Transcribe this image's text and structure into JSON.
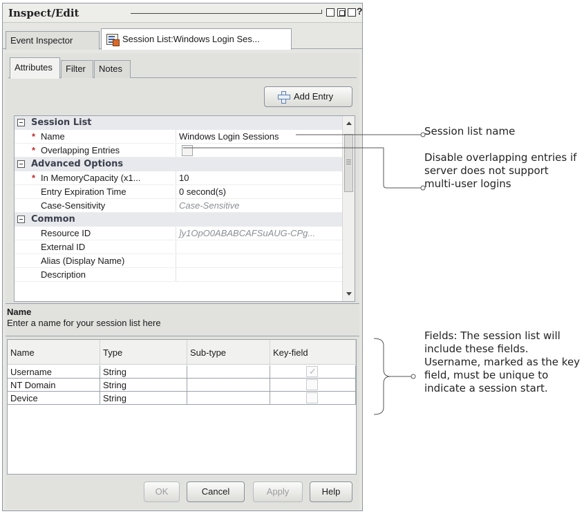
{
  "window": {
    "title": "Inspect/Edit",
    "help": "?"
  },
  "doc_tabs": [
    {
      "label": "Event Inspector"
    },
    {
      "label": "Session List:Windows Login Ses...",
      "icon": "session-list-icon"
    }
  ],
  "sub_tabs": [
    {
      "label": "Attributes"
    },
    {
      "label": "Filter"
    },
    {
      "label": "Notes"
    }
  ],
  "add_entry": {
    "label": "Add Entry",
    "icon": "plus-icon"
  },
  "properties": {
    "sections": {
      "session_list": "Session List",
      "advanced": "Advanced Options",
      "common": "Common"
    },
    "name": {
      "label": "Name",
      "value": "Windows Login Sessions"
    },
    "overlapping": {
      "label": "Overlapping Entries"
    },
    "in_memory": {
      "label": "In MemoryCapacity (x1...",
      "value": "10"
    },
    "expiration": {
      "label": "Entry Expiration Time",
      "value": "0 second(s)"
    },
    "case": {
      "label": "Case-Sensitivity",
      "value": "Case-Sensitive"
    },
    "resource_id": {
      "label": "Resource ID",
      "value": "]y1OpO0ABABCAFSuAUG-CPg..."
    },
    "external_id": {
      "label": "External ID"
    },
    "alias": {
      "label": "Alias (Display Name)"
    },
    "description": {
      "label": "Description"
    },
    "required_marker": "*"
  },
  "description": {
    "title": "Name",
    "text": "Enter a name for your session list here"
  },
  "fields": {
    "headers": [
      "Name",
      "Type",
      "Sub-type",
      "Key-field"
    ],
    "rows": [
      {
        "name": "Username",
        "type": "String",
        "subtype": "",
        "key": true
      },
      {
        "name": "NT Domain",
        "type": "String",
        "subtype": "",
        "key": false
      },
      {
        "name": "Device",
        "type": "String",
        "subtype": "",
        "key": false
      }
    ]
  },
  "buttons": {
    "ok": "OK",
    "cancel": "Cancel",
    "apply": "Apply",
    "help": "Help"
  },
  "annotations": {
    "name": "Session list name",
    "overlapping": "Disable overlapping entries if server does not support multi-user logins",
    "fields": "Fields: The session list will include these fields. Username, marked as the key field, must be unique to indicate a session start."
  }
}
